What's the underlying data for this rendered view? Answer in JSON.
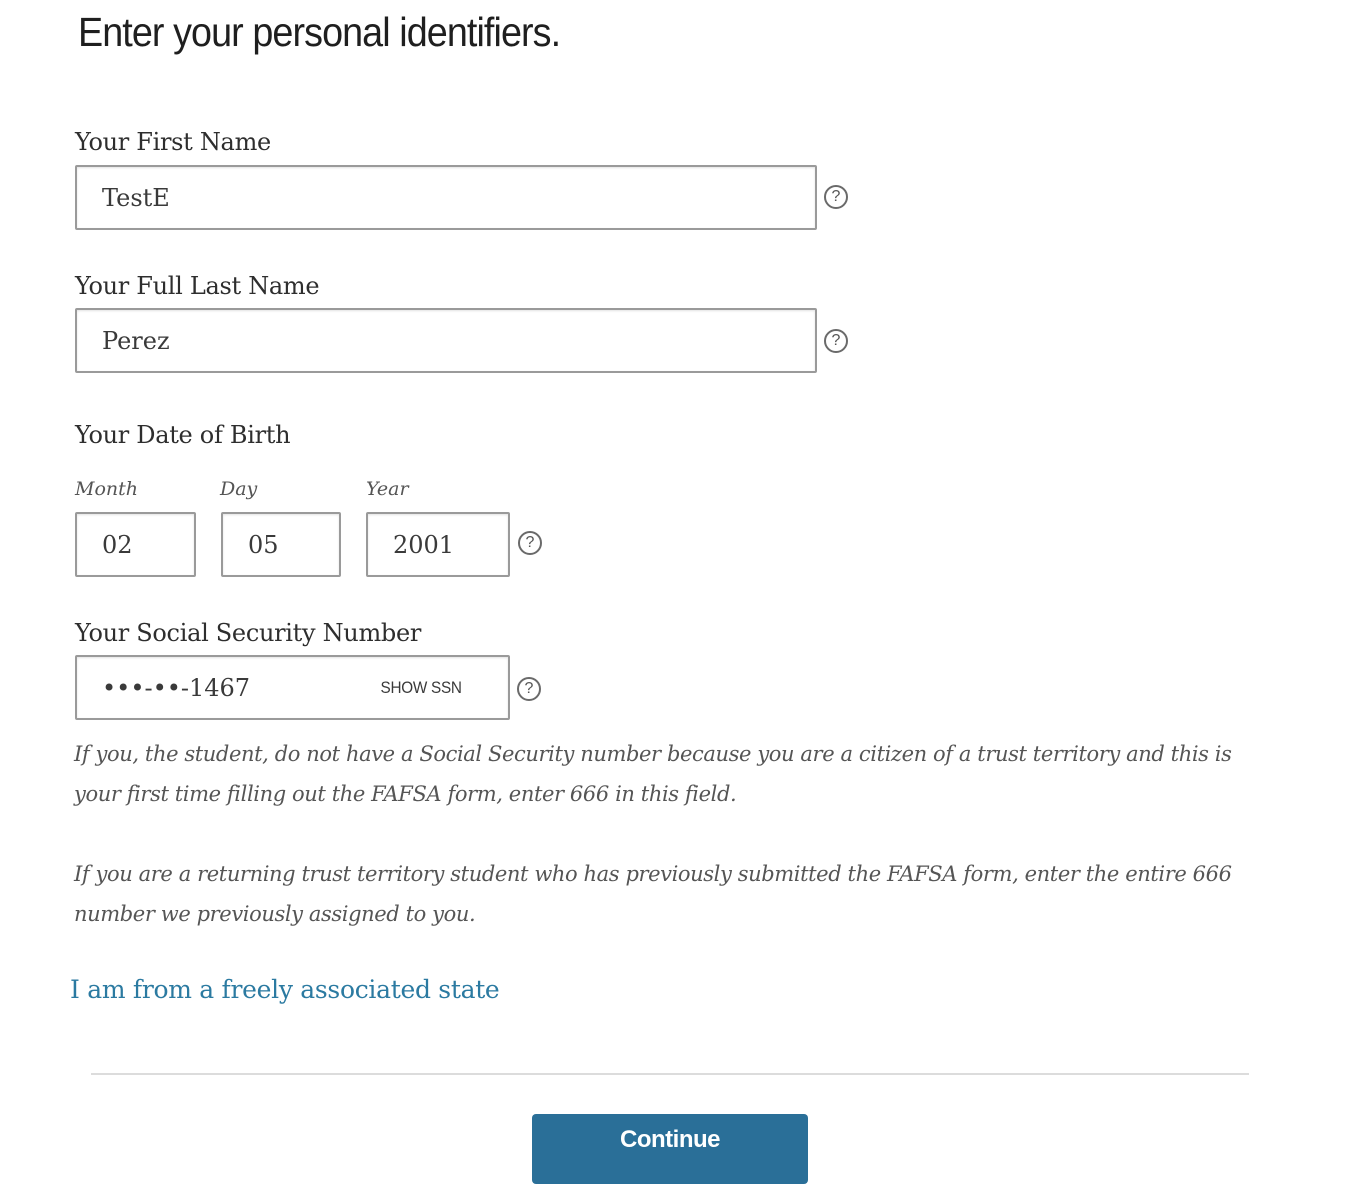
{
  "page": {
    "title": "Enter your personal identifiers."
  },
  "fields": {
    "first_name": {
      "label": "Your First Name",
      "value": "TestE",
      "help_icon": "question-circle-icon"
    },
    "last_name": {
      "label": "Your Full Last Name",
      "value": "Perez",
      "help_icon": "question-circle-icon"
    },
    "dob": {
      "label": "Your Date of Birth",
      "month_label": "Month",
      "month_value": "02",
      "day_label": "Day",
      "day_value": "05",
      "year_label": "Year",
      "year_value": "2001",
      "help_icon": "question-circle-icon"
    },
    "ssn": {
      "label": "Your Social Security Number",
      "value": "•••-••-1467",
      "toggle_label": "SHOW SSN",
      "help_icon": "question-circle-icon"
    }
  },
  "help_glyph": "?",
  "notes": {
    "trust_territory_first": "If you, the student, do not have a Social Security number because you are a citizen of a trust territory and this is your first time filling out the FAFSA form, enter 666 in this field.",
    "trust_territory_returning": "If you are a returning trust territory student who has previously submitted the FAFSA form, enter the entire 666 number we previously assigned to you."
  },
  "links": {
    "freely_associated_state": "I am from a freely associated state"
  },
  "actions": {
    "continue_label": "Continue"
  },
  "colors": {
    "link": "#2b7aa1",
    "primary_button": "#2a6f98",
    "input_border": "#9a9a9a"
  }
}
